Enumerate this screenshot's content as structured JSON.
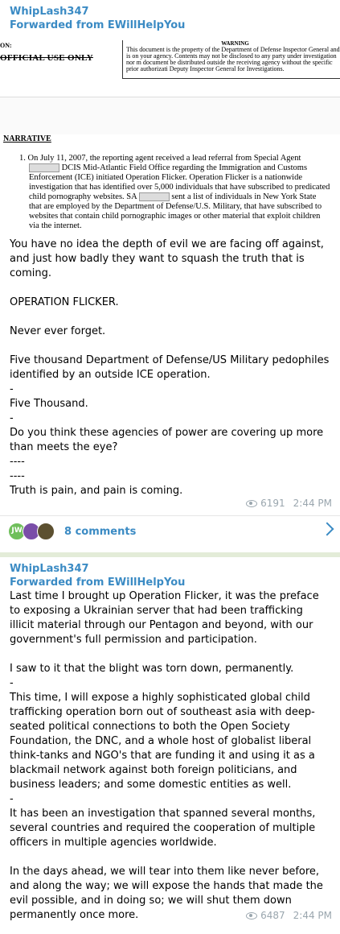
{
  "post1": {
    "sender": "WhipLash347",
    "forwarded_prefix": "Forwarded from ",
    "forwarded_from": "EWillHelpYou",
    "doc_header": {
      "left_fragment": "ON:",
      "ouo": "OFFICIAL USE ONLY",
      "warning_title": "WARNING",
      "warning_text": "This document is the property of the Department of Defense Inspector General and is on your agency. Contents may not be disclosed to any party under investigation nor m document be distributed outside the receiving agency without the specific prior authorizati Deputy Inspector General for Investigations."
    },
    "doc_body": {
      "heading": "NARRATIVE",
      "para_a": "1.  On July 11, 2007, the reporting agent received a lead referral from Special Agent",
      "para_b": "DCIS Mid-Atlantic Field Office regarding the Immigration and Customs Enforcement (ICE) initiated Operation Flicker.  Operation Flicker is a nationwide investigation that has identified over 5,000 individuals that have subscribed to predicated child pornography websites.  SA",
      "para_c": "sent a list of individuals in New York State that are employed by the Department of Defense/U.S. Military, that have subscribed to websites that contain child pornographic images or other material that exploit children via the internet."
    },
    "text": "You have no idea the depth of evil we are facing off against, and just how badly they want to squash the truth that is coming.\n\nOPERATION FLICKER.\n\nNever ever forget.\n\nFive thousand Department of Defense/US Military pedophiles identified by an outside ICE operation.\n-\nFive Thousand.\n-\nDo you think these agencies of power are covering up more than meets the eye?\n----\n----\nTruth is pain, and pain is coming.",
    "views": "6191",
    "time": "2:44 PM",
    "comments_label": "8 comments",
    "avatar_initials": "JW"
  },
  "post2": {
    "sender": "WhipLash347",
    "forwarded_prefix": "Forwarded from ",
    "forwarded_from": "EWillHelpYou",
    "text": "Last time I brought up Operation Flicker, it was the preface to exposing a Ukrainian server that had been trafficking illicit material through our Pentagon and beyond, with our government's full permission and participation.\n\nI saw to it that the blight was torn down, permanently.\n-\nThis time, I will expose a highly sophisticated global child trafficking operation born out of southeast asia with deep-seated political connections to both the Open Society Foundation, the DNC, and a whole host of globalist liberal think-tanks and NGO's that are funding it and using it as a blackmail network against both foreign politicians, and business leaders; and some domestic entities as well.\n-\nIt has been an investigation that spanned several months, several countries and required the cooperation of multiple officers in multiple agencies worldwide.\n\nIn the days ahead, we will tear into them like never before, and along the way; we will expose the hands that made the evil possible, and in doing so; we will shut them down permanently once more.",
    "views": "6487",
    "time": "2:44 PM"
  }
}
